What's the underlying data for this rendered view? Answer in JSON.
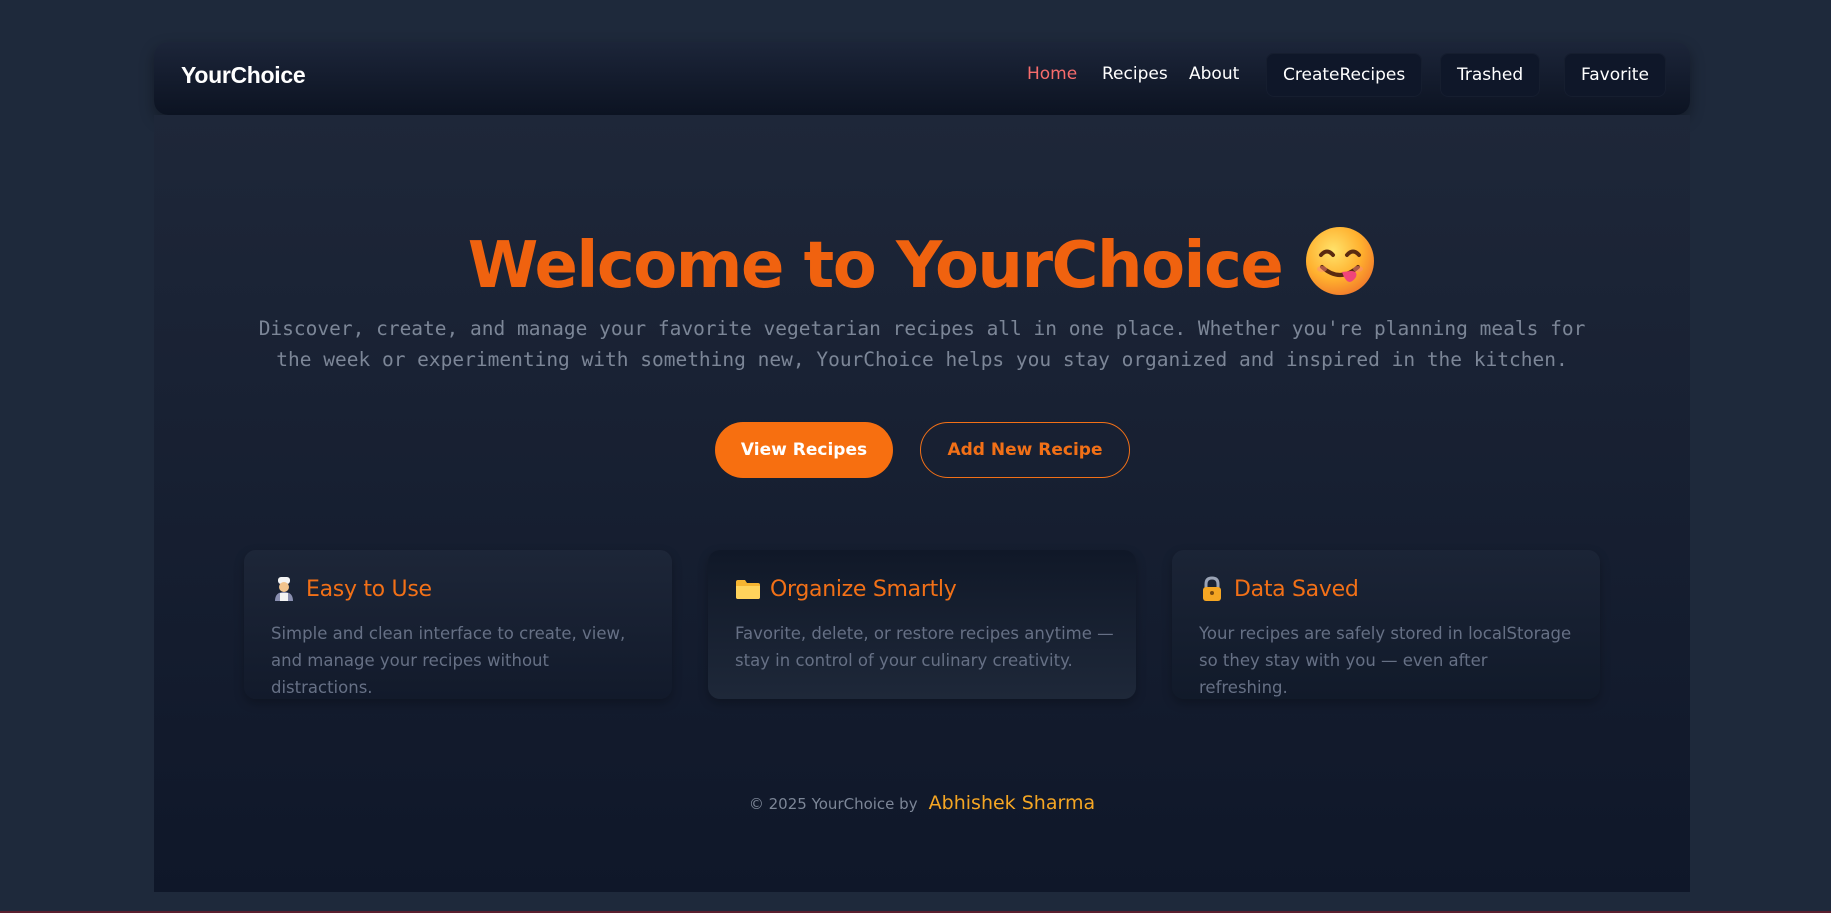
{
  "nav": {
    "brand": "YourChoice",
    "links": [
      {
        "label": "Home",
        "active": true
      },
      {
        "label": "Recipes",
        "active": false
      },
      {
        "label": "About",
        "active": false
      }
    ],
    "buttons": [
      {
        "label": "CreateRecipes"
      },
      {
        "label": "Trashed"
      },
      {
        "label": "Favorite"
      }
    ]
  },
  "hero": {
    "title": "Welcome to YourChoice",
    "emoji_icon": "face-savoring-food-icon",
    "subtitle": "Discover, create, and manage your favorite vegetarian recipes all in one place. Whether you're planning meals for the week or experimenting with something new, YourChoice helps you stay organized and inspired in the kitchen.",
    "primary_button": "View Recipes",
    "secondary_button": "Add New Recipe"
  },
  "features": [
    {
      "icon": "cook-icon",
      "title": "Easy to Use",
      "text": "Simple and clean interface to create, view, and manage your recipes without distractions."
    },
    {
      "icon": "folder-icon",
      "title": "Organize Smartly",
      "text": "Favorite, delete, or restore recipes anytime — stay in control of your culinary creativity."
    },
    {
      "icon": "lock-icon",
      "title": "Data Saved",
      "text": "Your recipes are safely stored in localStorage so they stay with you — even after refreshing."
    }
  ],
  "footer": {
    "copyright": "© 2025 YourChoice by",
    "author": "Abhishek Sharma"
  },
  "colors": {
    "accent": "#f76f10",
    "nav_active": "#f76c6c",
    "author": "#f5a623",
    "background": "#1e293b"
  }
}
